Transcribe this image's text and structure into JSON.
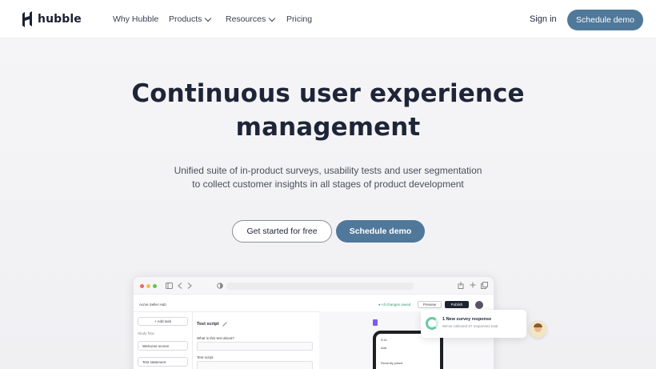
{
  "nav": {
    "logo_text": "hubble",
    "links": [
      {
        "label": "Why Hubble"
      },
      {
        "label": "Products"
      },
      {
        "label": "Resources"
      },
      {
        "label": "Pricing"
      }
    ],
    "signin_label": "Sign in",
    "demo_label": "Schedule demo"
  },
  "hero": {
    "title_line1": "Continuous user experience",
    "title_line2": "management",
    "subtitle_line1": "Unified suite of in-product surveys, usability tests and user segmentation",
    "subtitle_line2": "to collect customer insights in all stages of product development",
    "cta_primary": "Get started for free",
    "cta_secondary": "Schedule demo"
  },
  "mockup": {
    "workspace": "Acme Seller Hub",
    "saved_status": "All changes saved",
    "preview_label": "Preview",
    "publish_label": "Publish",
    "add_task_label": "+ Add task",
    "study_flow_label": "Study flow",
    "steps": [
      {
        "label": "Welcome screen"
      },
      {
        "label": "Test statement"
      }
    ],
    "test_script_title": "Test script",
    "question_label": "What is this test about?",
    "script_label": "Test script",
    "phone_tab": "Add",
    "phone_section": "Recently joined"
  },
  "notification": {
    "title": "1 New survey response",
    "body": "We've collected 67 responses total"
  },
  "colors": {
    "accent": "#50789a",
    "heading": "#1f2538",
    "ring": "#6bc7a4"
  }
}
